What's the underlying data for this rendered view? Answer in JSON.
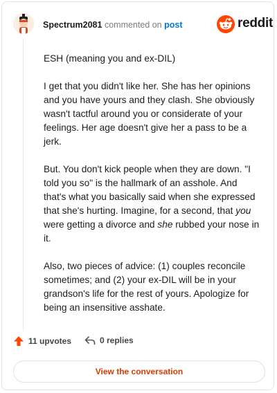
{
  "comment": {
    "username": "Spectrum2081",
    "action_text": "commented on",
    "post_link_text": "post",
    "paragraphs": [
      [
        {
          "t": "ESH (meaning you and ex-DIL)"
        }
      ],
      [
        {
          "t": "I get that you didn't like her. She has her opinions and you have yours and they clash. She obviously wasn't tactful around you or considerate of your feelings. Her age doesn't give her a pass to be a jerk."
        }
      ],
      [
        {
          "t": "But. You don't kick people when they are down. \"I told you so\" is the hallmark of an asshole. And that's what you basically said when she expressed that she's hurting. Imagine, for a second, that "
        },
        {
          "t": "you",
          "i": true
        },
        {
          "t": " were getting a divorce and "
        },
        {
          "t": "she",
          "i": true
        },
        {
          "t": " rubbed your nose in it."
        }
      ],
      [
        {
          "t": "Also, two pieces of advice: (1) couples reconcile sometimes; and (2) your ex-DIL will be in your grandson's life for the rest of yours. Apologize for being an insensitive asshate."
        }
      ]
    ],
    "upvotes_text": "11 upvotes",
    "replies_text": "0 replies"
  },
  "brand": {
    "name": "reddit",
    "icon": "reddit-logo-icon"
  },
  "cta": {
    "label": "View the conversation"
  },
  "colors": {
    "accent": "#ff4500",
    "link": "#0079d3",
    "cta_text": "#d93a00"
  }
}
